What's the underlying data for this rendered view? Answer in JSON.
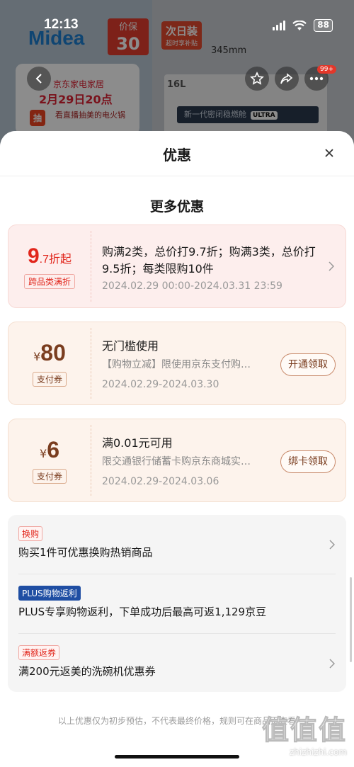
{
  "status_bar": {
    "time": "12:13",
    "battery": "88"
  },
  "background": {
    "brand_logo": "Midea",
    "price_guard": {
      "line1": "价保",
      "value": "30",
      "unit": "天"
    },
    "next_day": {
      "title": "次日装",
      "subtitle": "超时享补贴"
    },
    "dimension": "345mm",
    "promo": {
      "store": "京东家电家居",
      "date": "2月29日20点",
      "chip": "抽",
      "chip_text": "看直播抽美的电火锅"
    },
    "product_capacity": "16L",
    "product_strip": "新一代密闭稳燃舱",
    "product_strip_badge": "ULTRA",
    "cart_badge": "99+"
  },
  "sheet": {
    "title": "优惠",
    "section_title": "更多优惠",
    "coupons": [
      {
        "amount_big": "9",
        "amount_small": ".7",
        "amount_suffix": "折起",
        "tag": "跨品类满折",
        "main": "购满2类，总价打9.7折；购满3类，总价打9.5折；每类限购10件",
        "date": "2024.02.29 00:00-2024.03.31 23:59"
      },
      {
        "currency": "¥",
        "amount": "80",
        "tag": "支付券",
        "main": "无门槛使用",
        "sub": "【购物立减】限使用京东支付购买指定商品",
        "date": "2024.02.29-2024.03.30",
        "button": "开通领取"
      },
      {
        "currency": "¥",
        "amount": "6",
        "tag": "支付券",
        "main": "满0.01元可用",
        "sub": "限交通银行储蓄卡购京东商城实物商品",
        "date": "2024.02.29-2024.03.06",
        "button": "绑卡领取"
      }
    ],
    "perks": [
      {
        "tag": "换购",
        "text": "购买1件可优惠换购热销商品"
      },
      {
        "tag": "PLUS购物返利",
        "text": "PLUS专享购物返利，下单成功后最高可返1,129京豆"
      },
      {
        "tag": "满额返券",
        "text": "满200元返美的洗碗机优惠券"
      }
    ],
    "footer_note": "以上优惠仅为初步预估，不代表最终价格，规则可在商品页查看"
  },
  "watermark": {
    "logo": "值值值",
    "text": "zhizhizhi.com"
  },
  "colors": {
    "accent": "#e1251b",
    "coupon_bg": "#fdf3ec",
    "fold_bg": "#fde9e6"
  }
}
